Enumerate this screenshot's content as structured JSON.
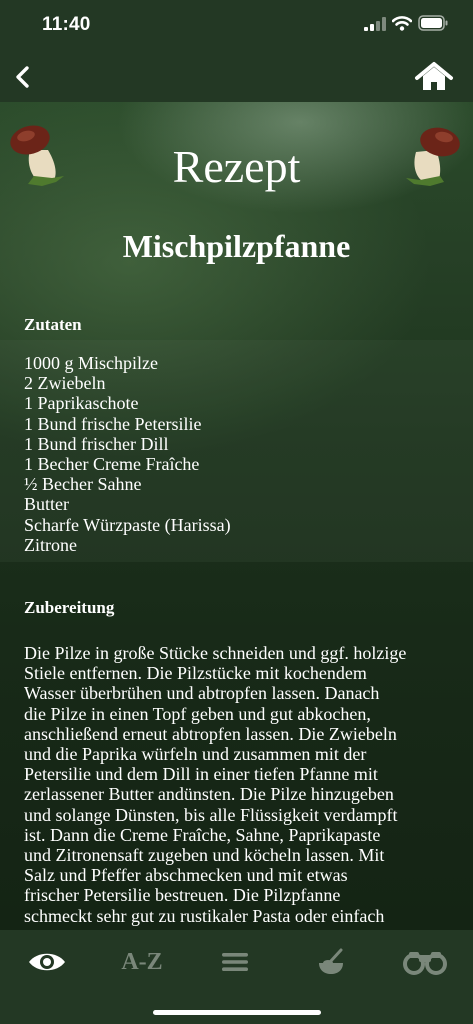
{
  "status_bar": {
    "time": "11:40"
  },
  "header": {
    "section_title": "Rezept"
  },
  "recipe": {
    "title": "Mischpilzpfanne",
    "ingredients_heading": "Zutaten",
    "ingredients": [
      "1000 g Mischpilze",
      "2 Zwiebeln",
      "1 Paprikaschote",
      "1 Bund frische Petersilie",
      "1 Bund frischer Dill",
      "1 Becher Creme Fraîche",
      "½ Becher Sahne",
      "Butter",
      "Scharfe Würzpaste (Harissa)",
      "Zitrone"
    ],
    "preparation_heading": "Zubereitung",
    "preparation_lines": [
      "Die Pilze in große Stücke schneiden und ggf. holzige",
      "Stiele entfernen. Die Pilzstücke mit kochendem",
      "Wasser überbrühen und abtropfen lassen. Danach",
      "die Pilze in einen Topf geben und gut abkochen,",
      "anschließend erneut abtropfen lassen. Die Zwiebeln",
      "und die Paprika würfeln und zusammen mit der",
      "Petersilie und dem Dill in einer tiefen Pfanne mit",
      "zerlassener Butter andünsten. Die Pilze hinzugeben",
      "und solange Dünsten, bis alle Flüssigkeit verdampft",
      "ist. Dann die Creme Fraîche, Sahne, Paprikapaste",
      "und Zitronensaft zugeben und köcheln lassen. Mit",
      "Salz und Pfeffer abschmecken und mit etwas",
      "frischer Petersilie bestreuen. Die Pilzpfanne",
      "schmeckt sehr gut zu rustikaler Pasta oder einfach"
    ]
  },
  "tab_bar": {
    "az_label": "A-Z",
    "active_tab": "eye",
    "active_color": "#ffffff",
    "inactive_color": "#7a877a"
  },
  "colors": {
    "bar_background": "#233824",
    "content_background": "#1e351e"
  },
  "icons": [
    "back-chevron-icon",
    "home-icon",
    "mushroom-icon",
    "eye-icon",
    "hamburger-menu-icon",
    "whisk-bowl-icon",
    "binoculars-icon"
  ]
}
